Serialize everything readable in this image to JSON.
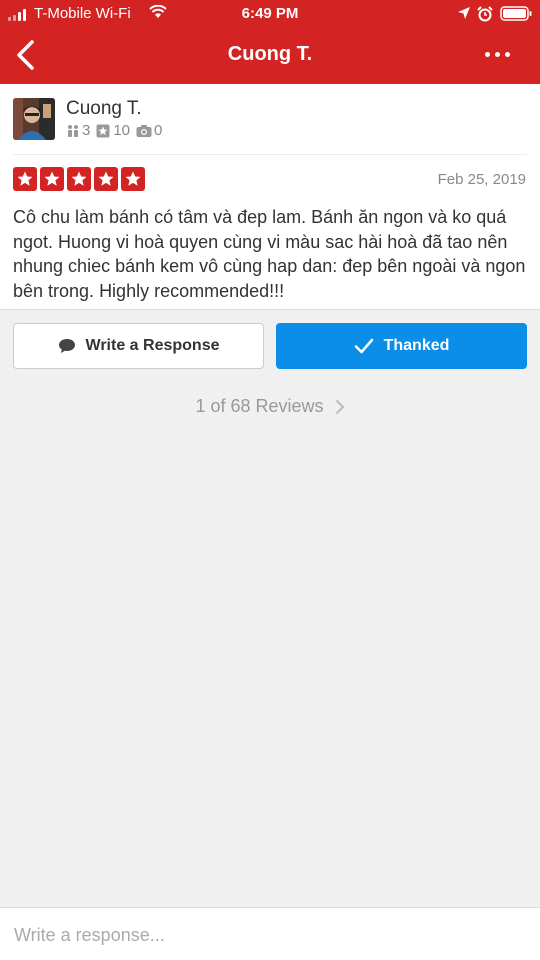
{
  "status_bar": {
    "carrier": "T-Mobile Wi-Fi",
    "time": "6:49 PM"
  },
  "nav": {
    "title": "Cuong T."
  },
  "review": {
    "user": {
      "name": "Cuong T.",
      "friends": "3",
      "reviews": "10",
      "photos": "0"
    },
    "rating": 5,
    "date": "Feb 25, 2019",
    "text": "Cô chu làm bánh có tâm và đep lam. Bánh ăn ngon và ko quá ngot. Huong vi hoà quyen cùng vi màu sac hài hoà đã tao nên nhung chiec bánh kem vô cùng hap dan: đep bên ngoài và ngon bên trong. Highly recommended!!!"
  },
  "actions": {
    "write_response_label": "Write a Response",
    "thanked_label": "Thanked"
  },
  "pagination": {
    "label": "1 of 68 Reviews"
  },
  "response_input": {
    "placeholder": "Write a response..."
  },
  "colors": {
    "brand_red": "#d32323",
    "action_blue": "#0a8ee8"
  }
}
